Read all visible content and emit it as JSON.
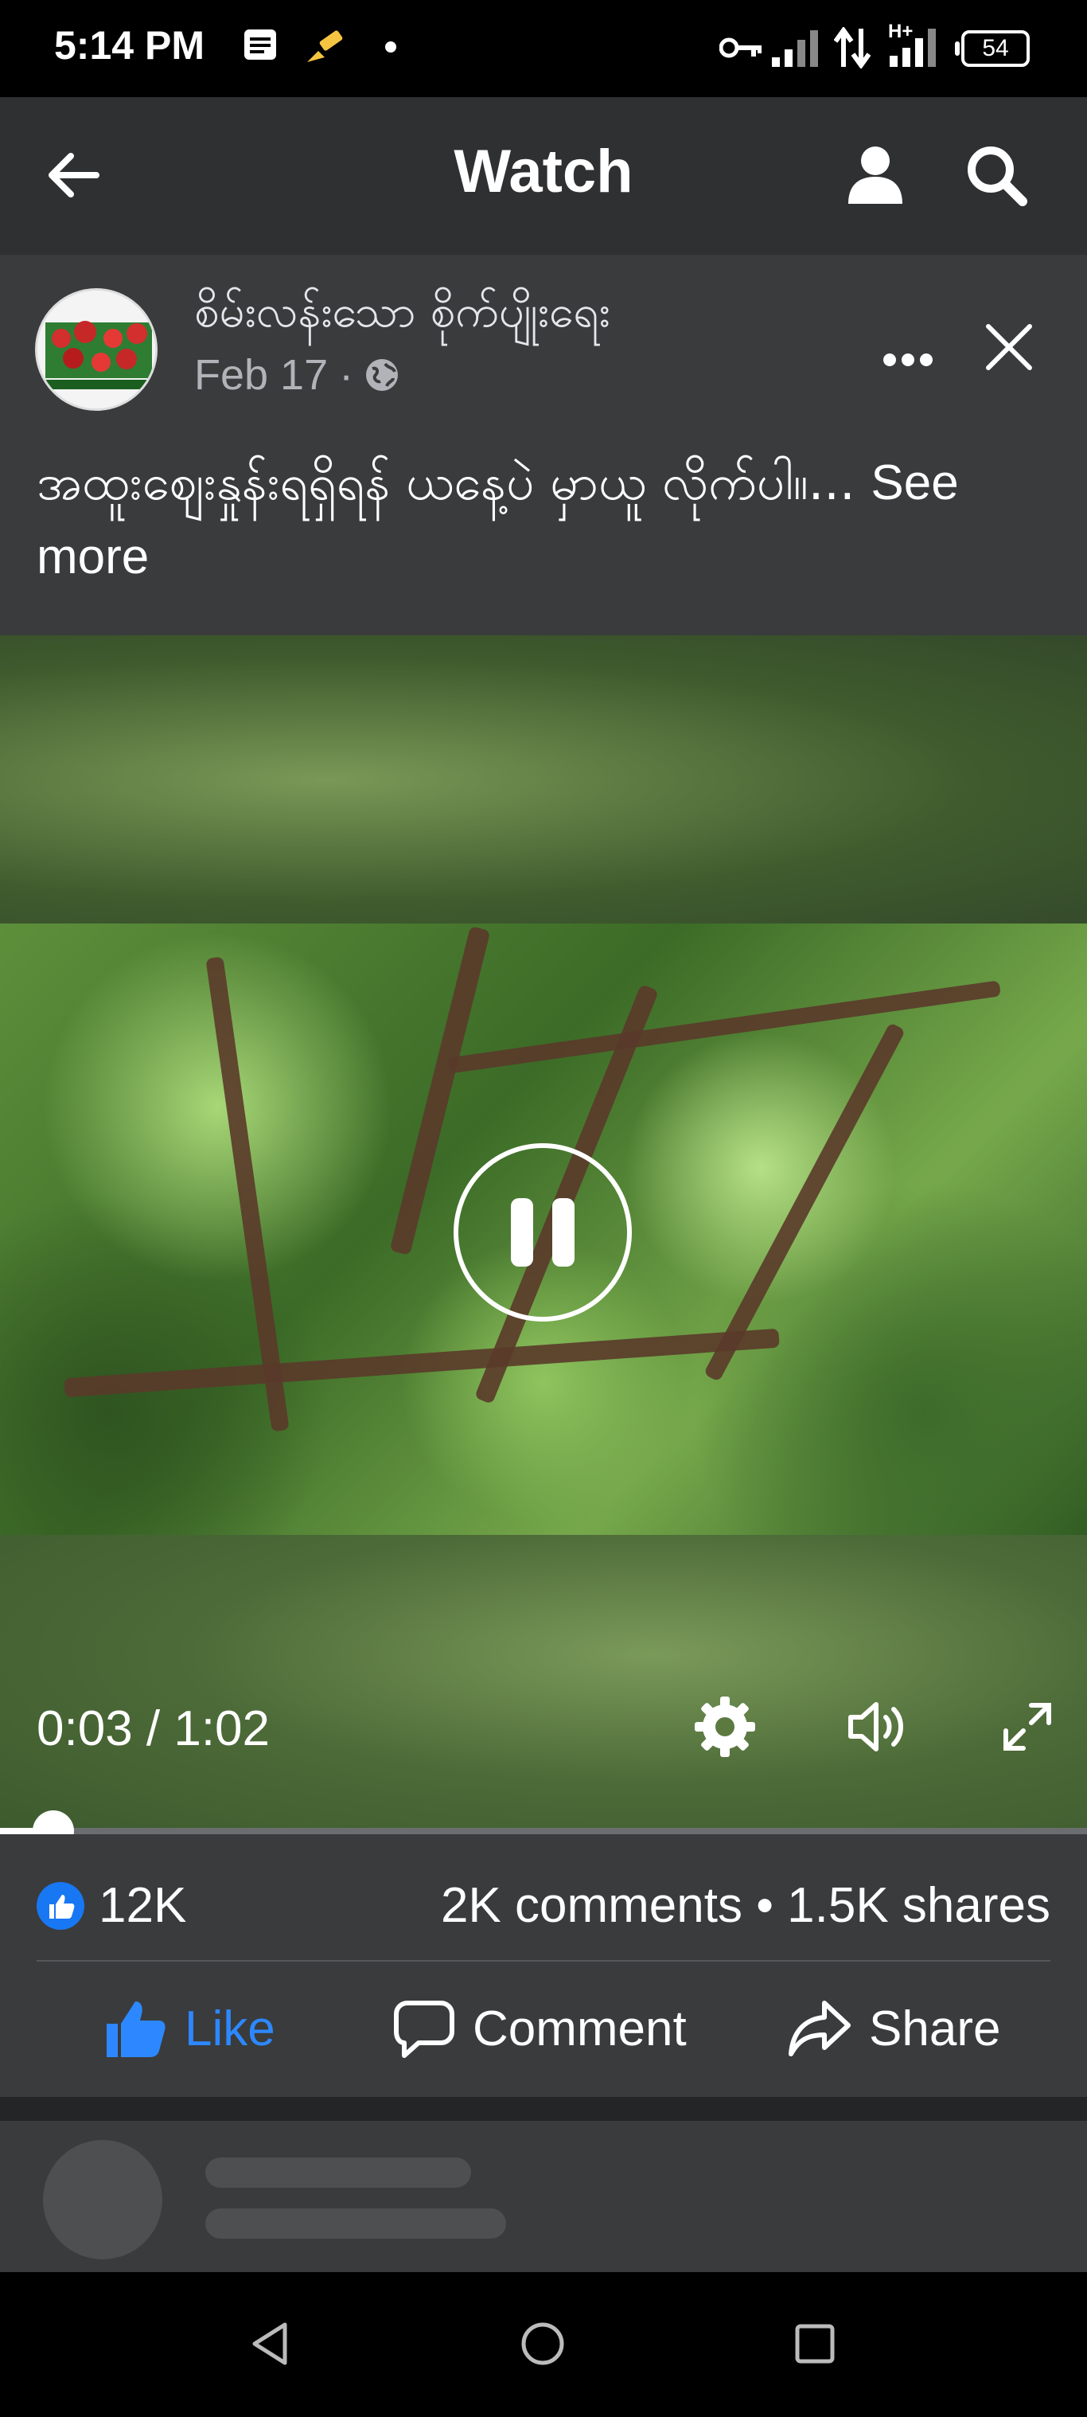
{
  "status_bar": {
    "time": "5:14 PM",
    "icons": [
      "notes-icon",
      "brush-icon",
      "dot-icon",
      "key-icon",
      "signal-icon",
      "data-arrows-icon",
      "signal-h-plus-icon"
    ],
    "network_label": "H+",
    "battery": "54"
  },
  "topnav": {
    "title": "Watch",
    "icons": [
      "back-arrow-icon",
      "profile-icon",
      "search-icon"
    ]
  },
  "post": {
    "page_name": "စိမ်းလန်းသော စိုက်ပျိုးရေး",
    "date": "Feb 17",
    "separator": "·",
    "privacy_icon": "globe-icon",
    "text": "အထူးဈေးနှုန်းရရှိရန် ယနေ့ပဲ မှာယူ လိုက်ပါ။...",
    "see_more": "See more"
  },
  "video": {
    "time_display": "0:03 / 1:02",
    "progress_fraction": 0.049,
    "controls": [
      "settings-gear-icon",
      "volume-icon",
      "fullscreen-icon"
    ],
    "state": "playing"
  },
  "engagement": {
    "like_count": "12K",
    "stats": "2K comments • 1.5K shares",
    "actions": {
      "like": "Like",
      "comment": "Comment",
      "share": "Share"
    }
  },
  "colors": {
    "accent": "#2d88ff",
    "like_badge": "#1877f2",
    "card_bg": "#3a3b3c",
    "nav_bg": "#2f3031"
  }
}
